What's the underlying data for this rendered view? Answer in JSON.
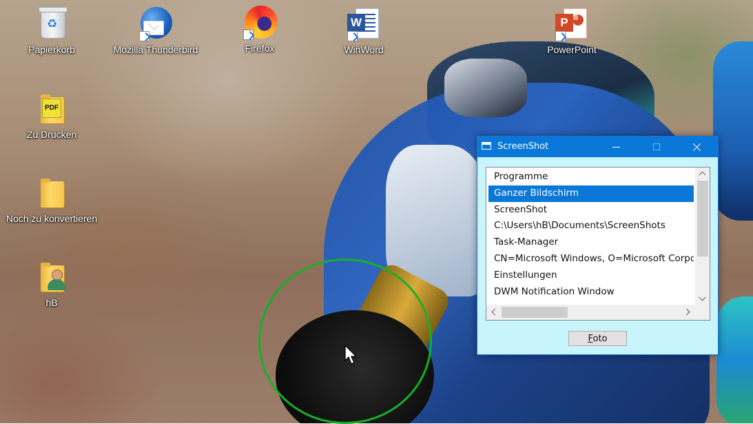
{
  "desktop": {
    "icons": [
      {
        "label": "Papierkorb",
        "icon": "recycle-bin-icon",
        "shortcut": false
      },
      {
        "label": "Mozilla Thunderbird",
        "icon": "thunderbird-icon",
        "shortcut": true
      },
      {
        "label": "Firefox",
        "icon": "firefox-icon",
        "shortcut": true
      },
      {
        "label": "WinWord",
        "icon": "word-icon",
        "shortcut": true,
        "badge": "W"
      },
      {
        "label": "PowerPoint",
        "icon": "powerpoint-icon",
        "shortcut": true,
        "badge": "P"
      },
      {
        "label": "Zu Drucken",
        "icon": "pdf-folder-icon",
        "shortcut": false,
        "badge": "PDF"
      },
      {
        "label": "Noch zu konvertieren",
        "icon": "folder-icon",
        "shortcut": false
      },
      {
        "label": "hB",
        "icon": "user-folder-icon",
        "shortcut": false
      }
    ]
  },
  "window": {
    "title": "ScreenShot",
    "list": {
      "items": [
        {
          "text": "Programme",
          "selected": false
        },
        {
          "text": "Ganzer Bildschirm",
          "selected": true
        },
        {
          "text": "ScreenShot",
          "selected": false
        },
        {
          "text": "C:\\Users\\hB\\Documents\\ScreenShots",
          "selected": false
        },
        {
          "text": "Task-Manager",
          "selected": false
        },
        {
          "text": "CN=Microsoft Windows, O=Microsoft Corporation",
          "selected": false
        },
        {
          "text": "Einstellungen",
          "selected": false
        },
        {
          "text": "DWM Notification Window",
          "selected": false
        }
      ]
    },
    "foto_label": "Foto"
  },
  "colors": {
    "titlebar": "#0a78d8",
    "window_bg": "#c8f4fb",
    "selection": "#0a78d8",
    "highlight_ring": "#16b028"
  }
}
